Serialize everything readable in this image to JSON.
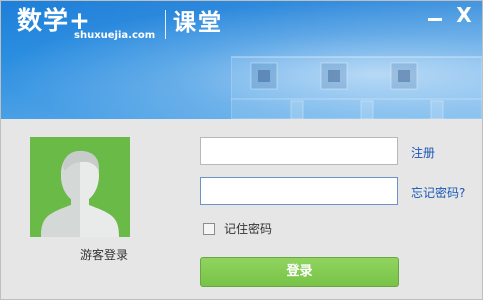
{
  "header": {
    "brand_title": "数学+",
    "brand_domain": "shuxuejia.com",
    "class_title": "课堂"
  },
  "window_controls": {
    "minimize_icon": "minimize-icon",
    "close_label": "X"
  },
  "avatar": {
    "icon": "user-silhouette-icon",
    "background_color": "#6aba48",
    "guest_login_label": "游客登录"
  },
  "form": {
    "username_value": "",
    "password_value": "",
    "register_link": "注册",
    "forgot_password_link": "忘记密码?",
    "remember_label": "记住密码",
    "remember_checked": false,
    "login_button": "登录"
  },
  "colors": {
    "header_blue": "#1d7fd9",
    "login_green": "#78c348",
    "link_blue": "#1a56b8"
  }
}
